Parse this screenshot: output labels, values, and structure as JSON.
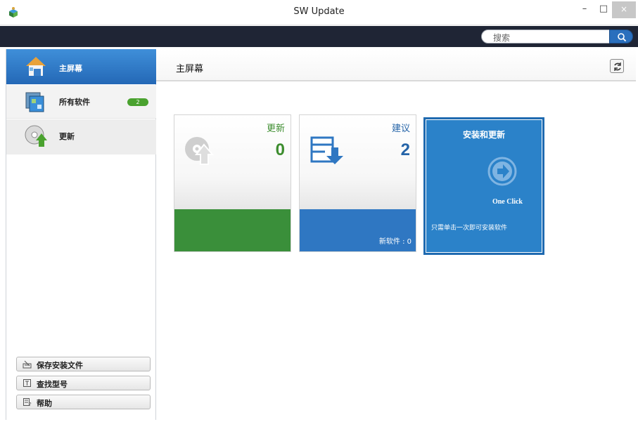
{
  "window": {
    "title": "SW Update",
    "minimize": "–",
    "maximize": "□",
    "close": "×"
  },
  "search": {
    "placeholder": "搜索"
  },
  "sidebar": {
    "items": [
      {
        "label": "主屏幕",
        "icon": "home-icon"
      },
      {
        "label": "所有软件",
        "icon": "all-software-icon",
        "badge": "2"
      },
      {
        "label": "更新",
        "icon": "update-disc-icon"
      }
    ],
    "buttons": [
      {
        "label": "保存安装文件",
        "icon": "save-icon"
      },
      {
        "label": "查找型号",
        "icon": "find-icon"
      },
      {
        "label": "帮助",
        "icon": "help-icon"
      }
    ]
  },
  "main": {
    "title": "主屏幕",
    "tiles": {
      "updates": {
        "label": "更新",
        "count": "0",
        "color": "#3d8d2f"
      },
      "suggestions": {
        "label": "建议",
        "count": "2",
        "new_software": "新软件 : 0",
        "color": "#2564a8"
      },
      "install": {
        "title": "安装和更新",
        "subtitle": "One Click",
        "description": "只需单击一次即可安装软件",
        "color": "#2b82c9"
      }
    }
  },
  "colors": {
    "accent": "#2468b6",
    "searchbar": "#1f2535",
    "green": "#3a8f3a"
  }
}
